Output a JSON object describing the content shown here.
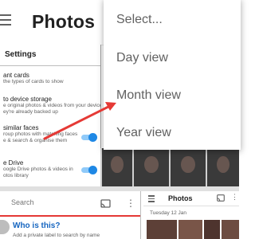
{
  "app": {
    "title": "Photos"
  },
  "menu": {
    "items": [
      "Select...",
      "Day view",
      "Month view",
      "Year view"
    ]
  },
  "settings": {
    "title": "Settings",
    "items": [
      {
        "title": "ant cards",
        "desc": [
          "the types of cards to show"
        ],
        "toggle": false
      },
      {
        "title": "to device storage",
        "desc": [
          "e original photos & videos from your device",
          "ey're already backed up"
        ],
        "toggle": false
      },
      {
        "title": "similar faces",
        "desc": [
          "roup photos with matching faces",
          "e & search & organise them"
        ],
        "toggle": true,
        "on": true
      },
      {
        "title": "e Drive",
        "desc": [
          "oogle Drive photos & videos in",
          "otos library"
        ],
        "toggle": true,
        "on": true
      }
    ]
  },
  "search": {
    "placeholder": "Search"
  },
  "who": {
    "title": "Who is this?",
    "desc": "Add a private label to search by name"
  },
  "mini": {
    "title": "Photos",
    "date": "Tuesday 12 Jan"
  },
  "colors": {
    "accent": "#1e88e5",
    "arrow": "#e53935",
    "link": "#1565c0"
  },
  "icons": {
    "menu": "hamburger-icon",
    "cast": "cast-icon",
    "more": "more-vert-icon"
  }
}
